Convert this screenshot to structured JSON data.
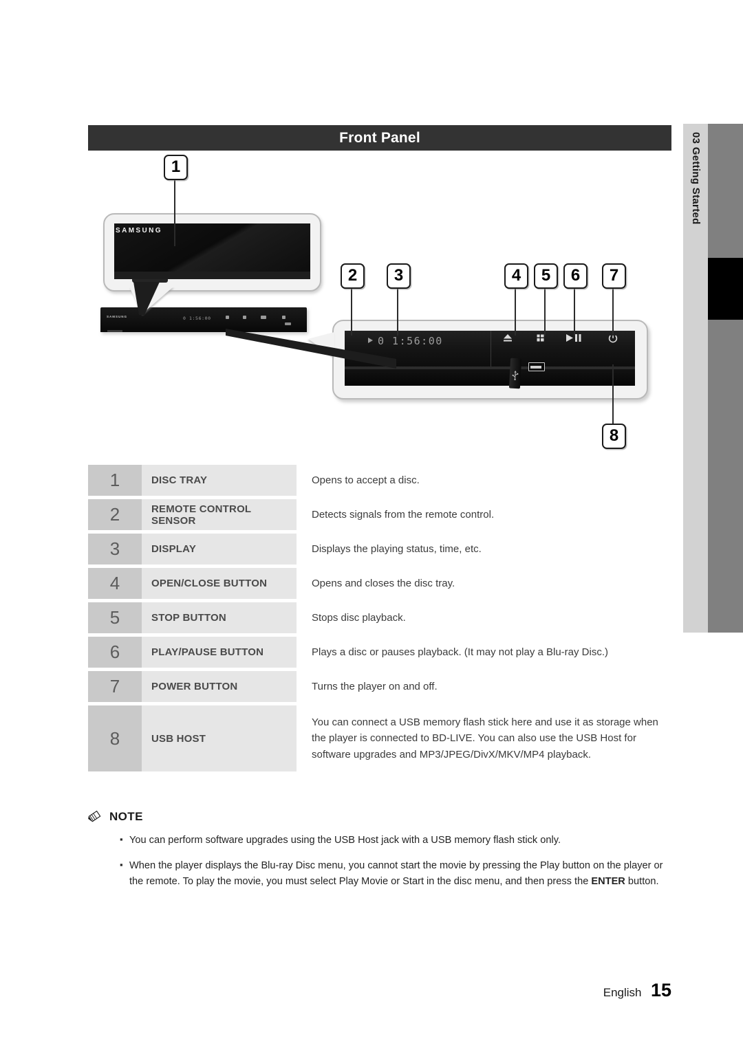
{
  "header": {
    "title": "Front Panel"
  },
  "side_tab": {
    "chapter_number": "03",
    "chapter_name": "Getting Started",
    "combined": "03   Getting Started"
  },
  "diagram": {
    "brand_logo": "SAMSUNG",
    "display_time": "0 1:56:00",
    "display_time_small": "0 1:56:00",
    "callouts": [
      {
        "id": "1",
        "label": "1"
      },
      {
        "id": "2",
        "label": "2"
      },
      {
        "id": "3",
        "label": "3"
      },
      {
        "id": "4",
        "label": "4"
      },
      {
        "id": "5",
        "label": "5"
      },
      {
        "id": "6",
        "label": "6"
      },
      {
        "id": "7",
        "label": "7"
      },
      {
        "id": "8",
        "label": "8"
      }
    ],
    "panel_buttons": [
      {
        "name": "eject-button",
        "glyph": "⏏"
      },
      {
        "name": "stop-button",
        "glyph": "■"
      },
      {
        "name": "play-pause-button",
        "glyph": "▶❚❚"
      },
      {
        "name": "power-button",
        "glyph": "⏻"
      }
    ],
    "usb_glyph": "⑂"
  },
  "table": {
    "rows": [
      {
        "num": "1",
        "label": "DISC TRAY",
        "desc": "Opens to accept a disc."
      },
      {
        "num": "2",
        "label": "REMOTE CONTROL SENSOR",
        "desc": "Detects signals from the remote control."
      },
      {
        "num": "3",
        "label": "DISPLAY",
        "desc": "Displays the playing status, time, etc."
      },
      {
        "num": "4",
        "label": "OPEN/CLOSE BUTTON",
        "desc": "Opens and closes the disc tray."
      },
      {
        "num": "5",
        "label": "STOP BUTTON",
        "desc": "Stops disc playback."
      },
      {
        "num": "6",
        "label": "PLAY/PAUSE BUTTON",
        "desc": "Plays a disc or pauses playback. (It may not play a Blu-ray Disc.)"
      },
      {
        "num": "7",
        "label": "POWER BUTTON",
        "desc": "Turns the player on and off."
      },
      {
        "num": "8",
        "label": "USB HOST",
        "desc": "You can connect a USB memory flash stick here and use it as storage when the player is connected to BD-LIVE. You can also use the USB Host for software upgrades and MP3/JPEG/DivX/MKV/MP4 playback."
      }
    ]
  },
  "note": {
    "icon": "pencil-icon",
    "title": "NOTE",
    "bullet_char": "▪",
    "items": [
      "You can perform software upgrades using the USB Host jack with a USB memory flash stick only.",
      "When the player displays the Blu-ray Disc menu, you cannot start the movie by pressing the Play button on the player or the remote. To play the movie, you must select Play Movie or Start in the disc menu, and then press the ENTER button."
    ],
    "item2_prefix": "When the player displays the Blu-ray Disc menu, you cannot start the movie by pressing the Play button on the player or the remote. To play the movie, you must select Play Movie or Start in the disc menu, and then press the ",
    "item2_bold": "ENTER",
    "item2_suffix": " button."
  },
  "footer": {
    "language": "English",
    "page_number": "15"
  },
  "colors": {
    "header_bar": "#333333",
    "table_num_cell": "#c9c9c9",
    "table_label_cell": "#e6e6e6",
    "side_tab": "#d2d2d2",
    "side_bar": "#808080"
  }
}
